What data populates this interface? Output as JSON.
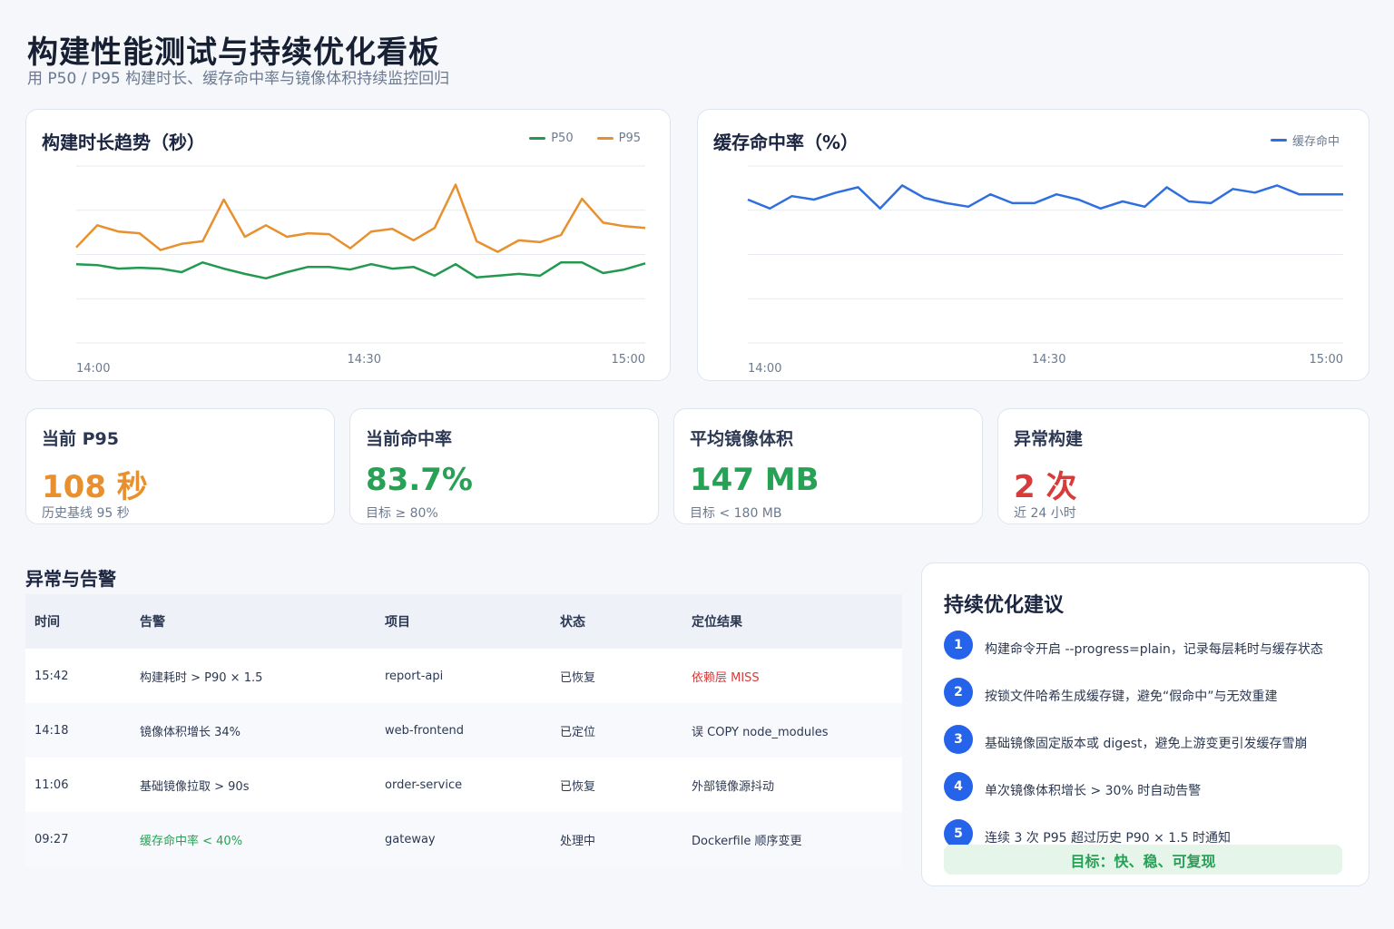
{
  "header": {
    "title": "构建性能测试与持续优化看板",
    "subtitle": "用 P50 / P95 构建时长、缓存命中率与镜像体积持续监控回归"
  },
  "colors": {
    "p50": "#22994f",
    "p95": "#e8902e",
    "hit": "#2f6fdf",
    "orange": "#e8902e",
    "green": "#27a155",
    "red": "#d93a3a"
  },
  "chart_data": [
    {
      "type": "line",
      "title": "构建时长趋势（秒）",
      "x_ticks": [
        "14:00",
        "14:30",
        "15:00"
      ],
      "ylim": [
        0,
        200
      ],
      "grid": true,
      "legend": "top-right",
      "series": [
        {
          "name": "P50",
          "values": [
            89,
            88,
            84,
            85,
            84,
            80,
            91,
            84,
            78,
            73,
            80,
            86,
            86,
            83,
            89,
            84,
            86,
            76,
            89,
            74,
            76,
            78,
            76,
            91,
            91,
            79,
            83,
            90
          ]
        },
        {
          "name": "P95",
          "values": [
            108,
            133,
            126,
            124,
            105,
            112,
            115,
            162,
            120,
            133,
            120,
            124,
            123,
            107,
            126,
            129,
            116,
            130,
            179,
            115,
            103,
            116,
            114,
            122,
            163,
            136,
            132,
            130
          ]
        }
      ]
    },
    {
      "type": "line",
      "title": "缓存命中率（%）",
      "x_ticks": [
        "14:00",
        "14:30",
        "15:00"
      ],
      "ylim": [
        0,
        100
      ],
      "grid": true,
      "legend": "top-right",
      "series": [
        {
          "name": "缓存命中",
          "values": [
            81,
            76,
            83,
            81,
            85,
            88,
            76,
            89,
            82,
            79,
            77,
            84,
            79,
            79,
            84,
            81,
            76,
            80,
            77,
            88,
            80,
            79,
            87,
            85,
            89,
            84,
            84,
            84
          ]
        }
      ]
    }
  ],
  "kpis": [
    {
      "label": "当前 P95",
      "value": "108 秒",
      "note": "历史基线 95 秒",
      "color": "#e8902e"
    },
    {
      "label": "当前命中率",
      "value": "83.7%",
      "note": "目标 ≥ 80%",
      "color": "#27a155"
    },
    {
      "label": "平均镜像体积",
      "value": "147 MB",
      "note": "目标 < 180 MB",
      "color": "#27a155"
    },
    {
      "label": "异常构建",
      "value": "2 次",
      "note": "近 24 小时",
      "color": "#d93a3a"
    }
  ],
  "alerts": {
    "title": "异常与告警",
    "columns": [
      "时间",
      "告警",
      "项目",
      "状态",
      "定位结果"
    ],
    "rows": [
      {
        "time": "15:42",
        "alert": "构建耗时 > P90 × 1.5",
        "project": "report-api",
        "status": "已恢复",
        "result": "依赖层 MISS",
        "alert_tone": "",
        "result_tone": "red"
      },
      {
        "time": "14:18",
        "alert": "镜像体积增长 34%",
        "project": "web-frontend",
        "status": "已定位",
        "result": "误 COPY node_modules",
        "alert_tone": "",
        "result_tone": ""
      },
      {
        "time": "11:06",
        "alert": "基础镜像拉取 > 90s",
        "project": "order-service",
        "status": "已恢复",
        "result": "外部镜像源抖动",
        "alert_tone": "",
        "result_tone": ""
      },
      {
        "time": "09:27",
        "alert": "缓存命中率 < 40%",
        "project": "gateway",
        "status": "处理中",
        "result": "Dockerfile 顺序变更",
        "alert_tone": "green",
        "result_tone": ""
      }
    ]
  },
  "suggestions": {
    "title": "持续优化建议",
    "items": [
      {
        "num": "1",
        "text": "构建命令开启 --progress=plain，记录每层耗时与缓存状态"
      },
      {
        "num": "2",
        "text": "按锁文件哈希生成缓存键，避免“假命中”与无效重建"
      },
      {
        "num": "3",
        "text": "基础镜像固定版本或 digest，避免上游变更引发缓存雪崩"
      },
      {
        "num": "4",
        "text": "单次镜像体积增长 > 30% 时自动告警"
      },
      {
        "num": "5",
        "text": "连续 3 次 P95 超过历史 P90 × 1.5 时通知"
      }
    ],
    "goal": "目标：快、稳、可复现"
  }
}
